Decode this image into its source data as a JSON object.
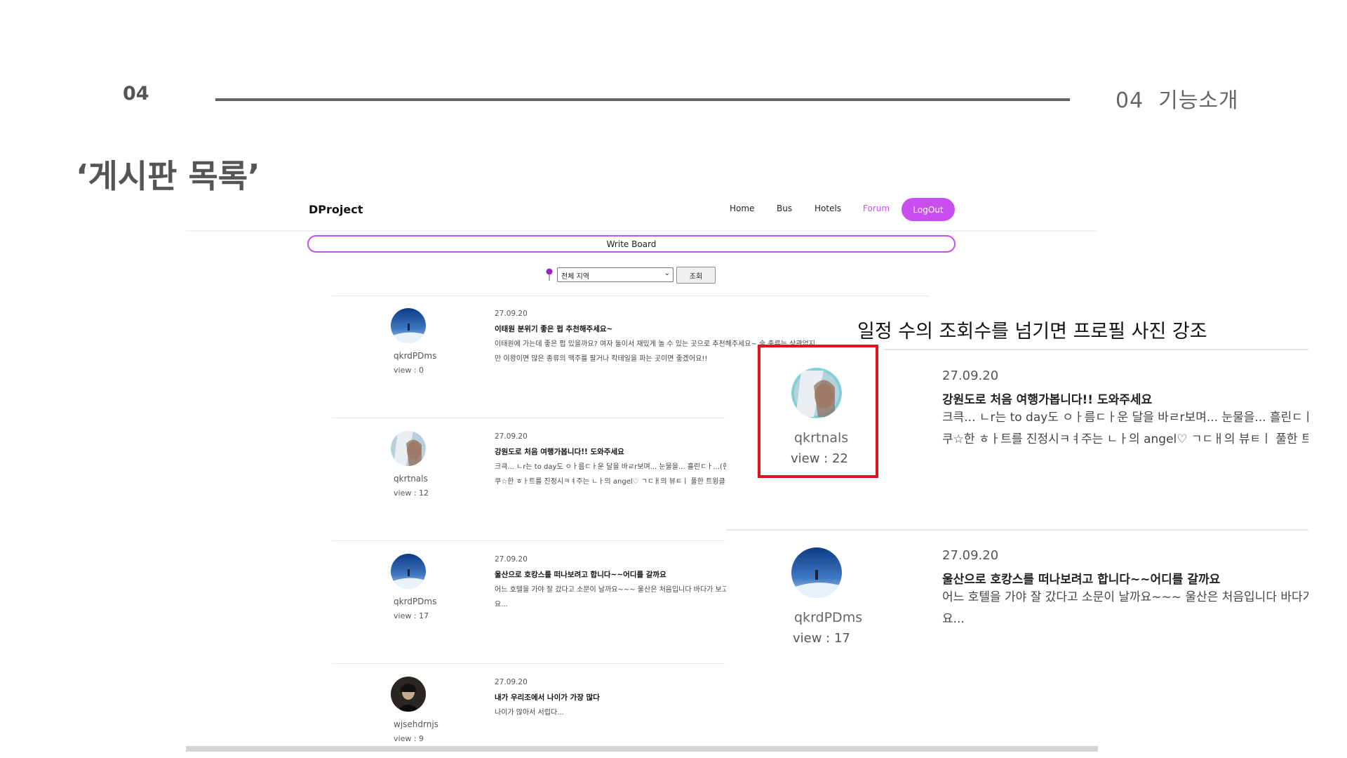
{
  "slide": {
    "number": "04",
    "section": "04  기능소개",
    "heading": "‘게시판 목록’"
  },
  "app": {
    "brand": "DProject",
    "nav": [
      "Home",
      "Bus",
      "Hotels",
      "Forum"
    ],
    "active_nav": "Forum",
    "logout_label": "LogOut",
    "accent_color": "#c84ef0",
    "write_board_label": "Write Board",
    "region_select_value": "전체 지역",
    "search_button_label": "조회"
  },
  "posts": [
    {
      "user": "qkrdPDms",
      "views": "view : 0",
      "date": "27.09.20",
      "title": "이태원 분위기 좋은 펍 추천해주세요~",
      "body": [
        "이태원에 가는데 좋은 펍 있을까요? 여자 둘이서 재밌게 놀 수 있는 곳으로 추천해주세요~ 술 종류는 상관없지",
        "만 이왕이면 많은 종류의 맥주를 팔거나 칵테일을 파는 곳이면 좋겠어요!!"
      ]
    },
    {
      "user": "qkrtnals",
      "views": "view : 12",
      "date": "27.09.20",
      "title": "강원도로 처음 여행가봅니다!! 도와주세요",
      "body": [
        "크큭... ㄴr는 to day도 ㅇㅏ름ㄷㅏ운 달을 바ㄹr보며... 눈물을... 흘린ㄷㅏ...(힌",
        "쿠☆한 ㅎㅏ트를 진정시ㅋㅕ주는 ㄴㅏ의 angel♡ ㄱㄷㅐ의 뷰ㅌㅣ 풀한 트윙클"
      ]
    },
    {
      "user": "qkrdPDms",
      "views": "view : 17",
      "date": "27.09.20",
      "title": "울산으로 호캉스를 떠나보려고 합니다~~어디를 갈까요",
      "body": [
        "어느 호텔을 가야 잘 갔다고 소문이 날까요~~~ 울산은 처음입니다 바다가 보고 싶어",
        "요..."
      ]
    },
    {
      "user": "wjsehdrnjs",
      "views": "view : 9",
      "date": "27.09.20",
      "title": "내가 우리조에서 나이가 가장 많다",
      "body": [
        "나이가 많아서 서럽다..."
      ]
    }
  ],
  "zoom": {
    "annotation": "일정 수의 조회수를 넘기면 프로필 사진 강조",
    "highlight_color": "#e0141e",
    "posts": [
      {
        "user": "qkrtnals",
        "views": "view : 22",
        "date": "27.09.20",
        "title": "강원도로 처음 여행가봅니다!! 도와주세요",
        "body": [
          "크큭... ㄴr는 to day도 ㅇㅏ름ㄷㅏ운 달을 바ㄹr보며... 눈물을... 흘린ㄷㅏ...(힌",
          "쿠☆한 ㅎㅏ트를 진정시ㅋㅕ주는 ㄴㅏ의 angel♡ ㄱㄷㅐ의 뷰ㅌㅣ 풀한 트윙클"
        ]
      },
      {
        "user": "qkrdPDms",
        "views": "view : 17",
        "date": "27.09.20",
        "title": "울산으로 호캉스를 떠나보려고 합니다~~어디를 갈까요",
        "body": [
          "어느 호텔을 가야 잘 갔다고 소문이 날까요~~~ 울산은 처음입니다 바다가 보고 싶어",
          "요..."
        ]
      }
    ]
  }
}
